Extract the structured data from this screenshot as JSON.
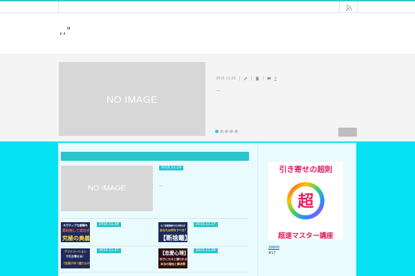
{
  "site": {
    "title": ",,\""
  },
  "topbar": {
    "rss_icon": "rss-icon"
  },
  "slider": {
    "image_text": "NO IMAGE",
    "date": "2015.11.29",
    "comment_count": "0",
    "excerpt": "...",
    "slide_count": 5,
    "active_slide": 1
  },
  "main": {
    "lead_article": {
      "image_text": "NO IMAGE",
      "date": "2015.11.29",
      "excerpt": "..."
    },
    "articles": [
      {
        "date": "2015.11.28",
        "thumb": [
          "ネガティブな感情を",
          "再利用して成功する",
          "究極の奥義"
        ]
      },
      {
        "date": "2015.11.27",
        "thumb": [
          "もう恋愛関係や引き寄せが",
          "あなたは何をすべき？",
          "【断捨離】"
        ]
      },
      {
        "date": "2015.11.27",
        "thumb": [
          "アファメーション",
          "で引き寄せる！",
          "【言葉が持つ魔力なの】"
        ]
      },
      {
        "date": "2015.11.26",
        "thumb": [
          "【恋愛心理】",
          "好きになると嫌われる",
          "本当の理由と解決策"
        ]
      }
    ]
  },
  "sidebar": {
    "banner_title": "引き寄せの超則",
    "banner_char": "超",
    "banner_subtitle": "超速マスター講座",
    "link": "29800",
    "text": "#17"
  },
  "colors": {
    "accent": "#29c4cc",
    "background": "#05e3f3"
  }
}
